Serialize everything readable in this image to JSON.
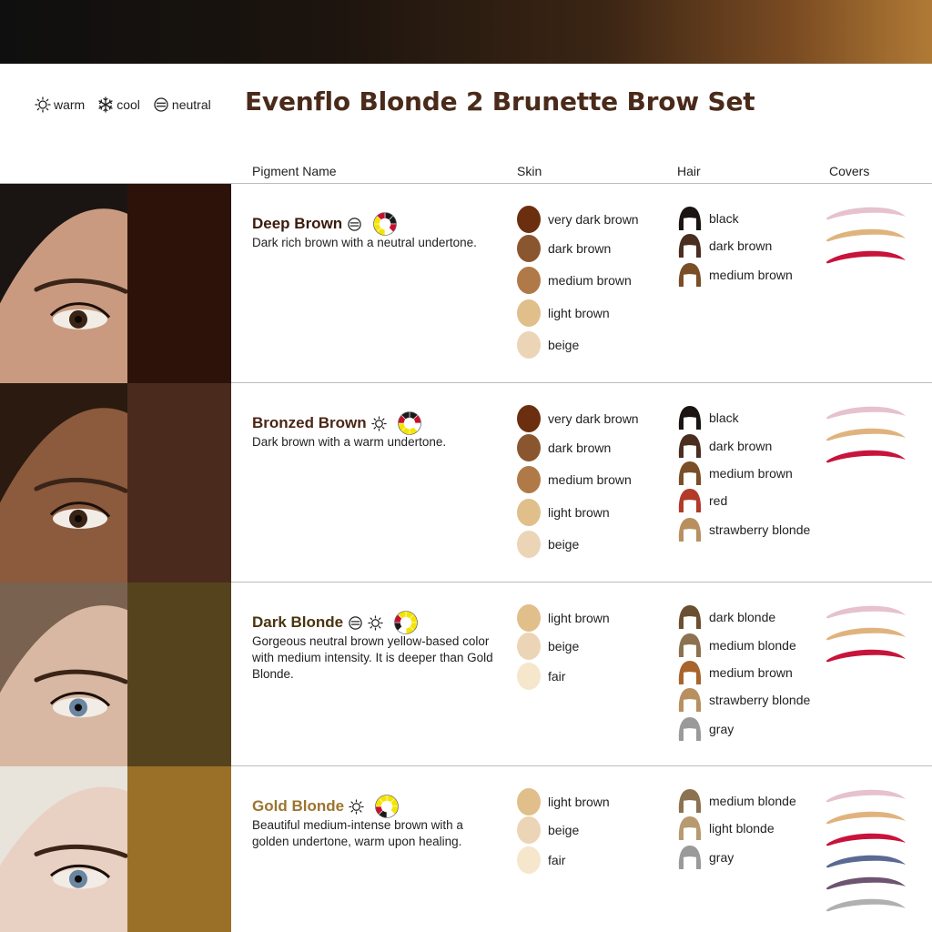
{
  "title": "Evenflo Blonde 2 Brunette Brow Set",
  "legend": {
    "warm": "warm",
    "cool": "cool",
    "neutral": "neutral"
  },
  "headers": {
    "pigment": "Pigment Name",
    "skin": "Skin",
    "hair": "Hair",
    "covers": "Covers"
  },
  "rows": [
    {
      "name": "Deep Brown",
      "name_color": "#3b1a0c",
      "swatch": "#2c1208",
      "description": "Dark rich brown with a neutral undertone.",
      "skin": [
        {
          "label": "very dark brown",
          "color": "#6b2f10"
        },
        {
          "label": "dark brown",
          "color": "#8a5630"
        },
        {
          "label": "medium brown",
          "color": "#b07a48"
        },
        {
          "label": "light brown",
          "color": "#e0bf8a"
        },
        {
          "label": "beige",
          "color": "#ecd5b6"
        }
      ],
      "hair": [
        {
          "label": "black",
          "color": "#1a1412"
        },
        {
          "label": "dark brown",
          "color": "#4a2e20"
        },
        {
          "label": "medium brown",
          "color": "#7a4e26"
        }
      ],
      "covers": [
        "#e6c1cf",
        "#e0b37e",
        "#c8143a"
      ]
    },
    {
      "name": "Bronzed Brown",
      "name_color": "#4a2616",
      "swatch": "#4a2a1c",
      "description": "Dark brown with a warm undertone.",
      "skin": [
        {
          "label": "very dark brown",
          "color": "#6b2f10"
        },
        {
          "label": "dark brown",
          "color": "#8a5630"
        },
        {
          "label": "medium brown",
          "color": "#b07a48"
        },
        {
          "label": "light brown",
          "color": "#e0bf8a"
        },
        {
          "label": "beige",
          "color": "#ecd5b6"
        }
      ],
      "hair": [
        {
          "label": "black",
          "color": "#1a1412"
        },
        {
          "label": "dark brown",
          "color": "#4a2e20"
        },
        {
          "label": "medium brown",
          "color": "#7a4e26"
        },
        {
          "label": "red",
          "color": "#b23a2a"
        },
        {
          "label": "strawberry blonde",
          "color": "#b89060"
        }
      ],
      "covers": [
        "#e6c1cf",
        "#e0b37e",
        "#c8143a"
      ]
    },
    {
      "name": "Dark Blonde",
      "name_color": "#4a3410",
      "swatch": "#55431e",
      "description": "Gorgeous neutral brown yellow-based color with medium intensity. It is deeper than Gold Blonde.",
      "skin": [
        {
          "label": "light brown",
          "color": "#e0bf8a"
        },
        {
          "label": "beige",
          "color": "#ecd5b6"
        },
        {
          "label": "fair",
          "color": "#f6e6cc"
        }
      ],
      "hair": [
        {
          "label": "dark blonde",
          "color": "#6a5030"
        },
        {
          "label": "medium blonde",
          "color": "#8c7250"
        },
        {
          "label": "medium brown",
          "color": "#a8642c"
        },
        {
          "label": "strawberry blonde",
          "color": "#b89060"
        },
        {
          "label": "gray",
          "color": "#9a9a9a"
        }
      ],
      "covers": [
        "#e6c1cf",
        "#e0b37e",
        "#c8143a"
      ]
    },
    {
      "name": "Gold Blonde",
      "name_color": "#9c7430",
      "swatch": "#9a7028",
      "description": "Beautiful medium-intense brown with a golden undertone, warm upon healing.",
      "skin": [
        {
          "label": "light brown",
          "color": "#e0bf8a"
        },
        {
          "label": "beige",
          "color": "#ecd5b6"
        },
        {
          "label": "fair",
          "color": "#f6e6cc"
        }
      ],
      "hair": [
        {
          "label": "medium blonde",
          "color": "#8c7250"
        },
        {
          "label": "light blonde",
          "color": "#b89a70"
        },
        {
          "label": "gray",
          "color": "#9a9a9a"
        }
      ],
      "covers": [
        "#e6c1cf",
        "#e0b37e",
        "#c8143a",
        "#5a6a92",
        "#6e5470",
        "#b0b0b0"
      ]
    }
  ],
  "icons": {
    "warm": "sun-icon",
    "cool": "snowflake-icon",
    "neutral": "neutral-circle-icon",
    "wheel": "color-wheel-icon"
  }
}
